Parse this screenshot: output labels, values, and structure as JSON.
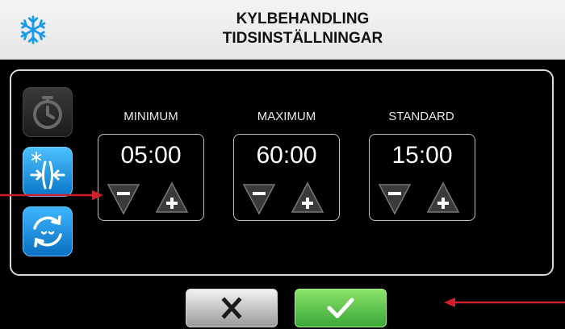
{
  "header": {
    "line1": "KYLBEHANDLING",
    "line2": "TIDSINSTÄLLNINGAR",
    "icon": "snowflake-icon"
  },
  "sidebar": {
    "buttons": [
      {
        "icon": "timer-icon",
        "enabled": false
      },
      {
        "icon": "cooling-icon",
        "enabled": true
      },
      {
        "icon": "cycle-icon",
        "enabled": true
      }
    ]
  },
  "settings": [
    {
      "label": "MINIMUM",
      "value": "05:00"
    },
    {
      "label": "MAXIMUM",
      "value": "60:00"
    },
    {
      "label": "STANDARD",
      "value": "15:00"
    }
  ],
  "footer": {
    "cancel_icon": "x-icon",
    "confirm_icon": "checkmark-icon"
  },
  "colors": {
    "header_bg": "#ececec",
    "accent_blue": "#1a8fe0",
    "confirm_green": "#4cbd43",
    "arrow_red": "#d01e2a"
  }
}
